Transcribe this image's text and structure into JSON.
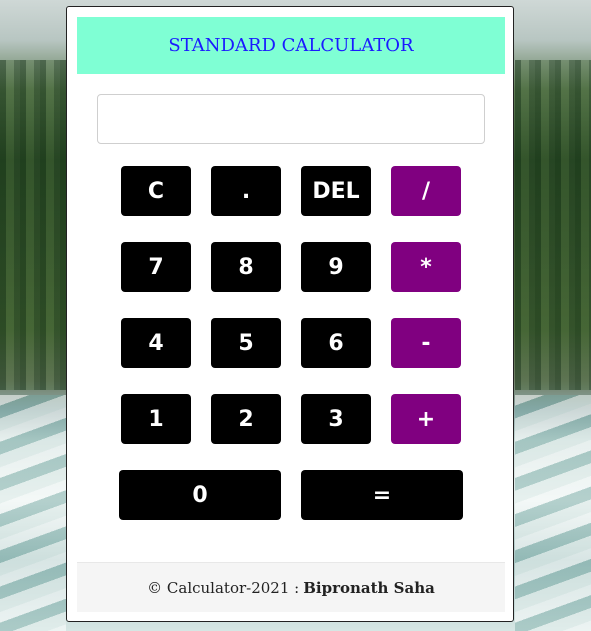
{
  "header": {
    "title": "STANDARD CALCULATOR"
  },
  "display": {
    "value": ""
  },
  "keys": {
    "row1": [
      "C",
      ".",
      "DEL",
      "/"
    ],
    "row2": [
      "7",
      "8",
      "9",
      "*"
    ],
    "row3": [
      "4",
      "5",
      "6",
      "-"
    ],
    "row4": [
      "1",
      "2",
      "3",
      "+"
    ],
    "row5": [
      "0",
      "="
    ]
  },
  "footer": {
    "copyright": "© Calculator-2021 :",
    "author": "Bipronath Saha"
  },
  "colors": {
    "header_bg": "#7fffd4",
    "header_text": "#1a1aff",
    "key_bg": "#000000",
    "operator_bg": "#800080",
    "key_text": "#ffffff"
  }
}
